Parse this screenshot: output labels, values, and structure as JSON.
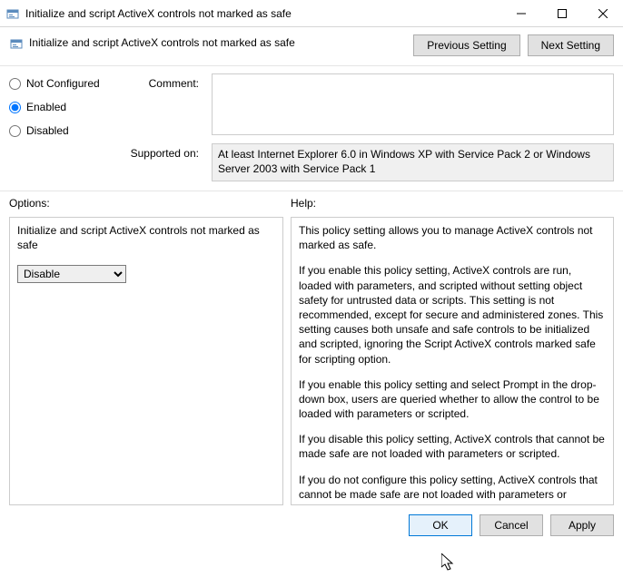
{
  "window": {
    "title": "Initialize and script ActiveX controls not marked as safe"
  },
  "header": {
    "title": "Initialize and script ActiveX controls not marked as safe",
    "prev_btn": "Previous Setting",
    "next_btn": "Next Setting"
  },
  "config": {
    "not_configured": "Not Configured",
    "enabled": "Enabled",
    "disabled": "Disabled",
    "comment_label": "Comment:",
    "comment_value": "",
    "supported_label": "Supported on:",
    "supported_value": "At least Internet Explorer 6.0 in Windows XP with Service Pack 2 or Windows Server 2003 with Service Pack 1"
  },
  "sections": {
    "options_label": "Options:",
    "help_label": "Help:"
  },
  "options": {
    "title": "Initialize and script ActiveX controls not marked as safe",
    "selected": "Disable"
  },
  "help": {
    "p1": "This policy setting allows you to manage ActiveX controls not marked as safe.",
    "p2": "If you enable this policy setting, ActiveX controls are run, loaded with parameters, and scripted without setting object safety for untrusted data or scripts. This setting is not recommended, except for secure and administered zones. This setting causes both unsafe and safe controls to be initialized and scripted, ignoring the Script ActiveX controls marked safe for scripting option.",
    "p3": "If you enable this policy setting and select Prompt in the drop-down box, users are queried whether to allow the control to be loaded with parameters or scripted.",
    "p4": "If you disable this policy setting, ActiveX controls that cannot be made safe are not loaded with parameters or scripted.",
    "p5": "If you do not configure this policy setting, ActiveX controls that cannot be made safe are not loaded with parameters or scripted."
  },
  "buttons": {
    "ok": "OK",
    "cancel": "Cancel",
    "apply": "Apply"
  }
}
